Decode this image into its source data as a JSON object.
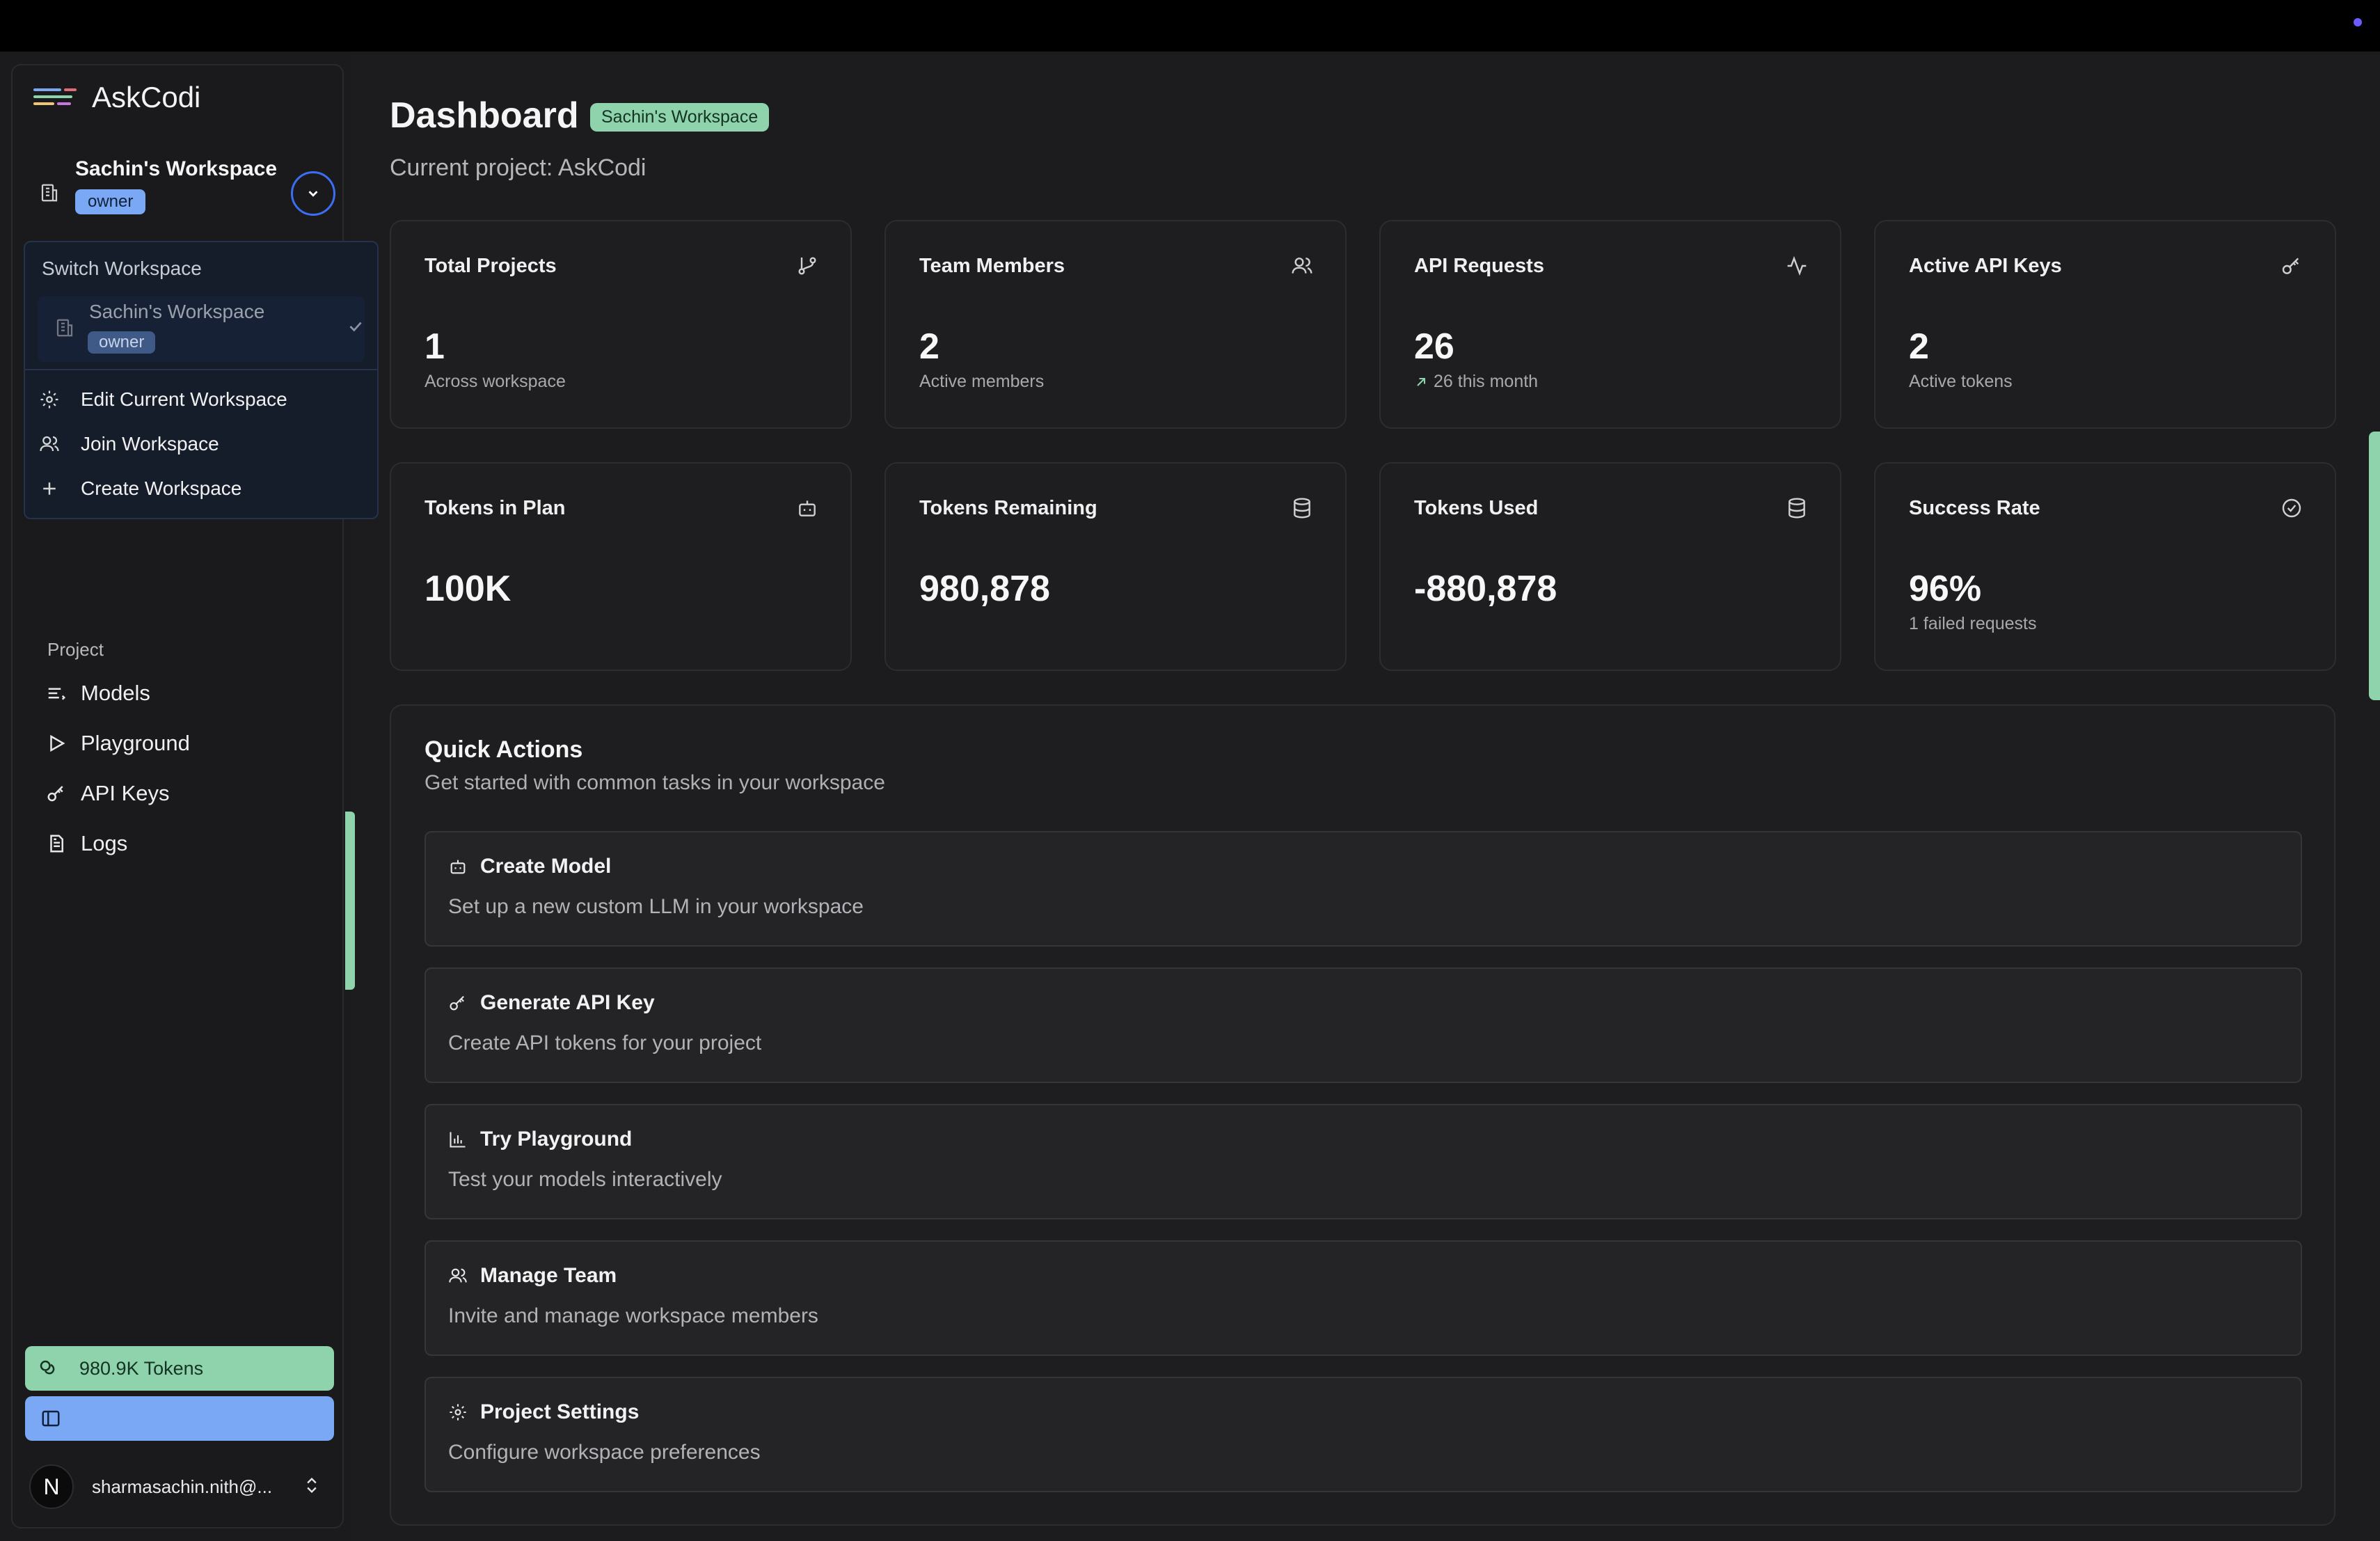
{
  "app": {
    "name": "AskCodi",
    "colors": {
      "accent_green": "#8fd3ad",
      "accent_blue": "#7aa8f5",
      "ring_blue": "#3b6ef2"
    }
  },
  "workspace": {
    "name": "Sachin's Workspace",
    "role": "owner"
  },
  "workspace_menu": {
    "title": "Switch Workspace",
    "items": [
      {
        "name": "Sachin's Workspace",
        "role": "owner",
        "selected": true
      }
    ],
    "actions": [
      {
        "label": "Edit Current Workspace",
        "icon": "gear-icon"
      },
      {
        "label": "Join Workspace",
        "icon": "users-icon"
      },
      {
        "label": "Create Workspace",
        "icon": "plus-icon"
      }
    ]
  },
  "sidebar": {
    "section_label": "Project",
    "items": [
      {
        "label": "Models",
        "icon": "list-icon"
      },
      {
        "label": "Playground",
        "icon": "play-icon"
      },
      {
        "label": "API Keys",
        "icon": "key-icon"
      },
      {
        "label": "Logs",
        "icon": "file-icon"
      }
    ],
    "tokens_label": "980.9K Tokens",
    "user_email": "sharmasachin.nith@...",
    "avatar_initial": "N"
  },
  "header": {
    "title": "Dashboard",
    "workspace_pill": "Sachin's Workspace",
    "subtitle": "Current project: AskCodi"
  },
  "stats": [
    {
      "label": "Total Projects",
      "value": "1",
      "sub": "Across workspace",
      "icon": "branch-icon"
    },
    {
      "label": "Team Members",
      "value": "2",
      "sub": "Active members",
      "icon": "users-icon"
    },
    {
      "label": "API Requests",
      "value": "26",
      "sub": "26 this month",
      "icon": "activity-icon",
      "trend": "up"
    },
    {
      "label": "Active API Keys",
      "value": "2",
      "sub": "Active tokens",
      "icon": "key-icon"
    },
    {
      "label": "Tokens in Plan",
      "value": "100K",
      "sub": "",
      "icon": "bot-icon"
    },
    {
      "label": "Tokens Remaining",
      "value": "980,878",
      "sub": "",
      "icon": "database-icon"
    },
    {
      "label": "Tokens Used",
      "value": "-880,878",
      "sub": "",
      "icon": "database-icon"
    },
    {
      "label": "Success Rate",
      "value": "96%",
      "sub": "1 failed requests",
      "icon": "check-circle-icon"
    }
  ],
  "quick_actions": {
    "title": "Quick Actions",
    "subtitle": "Get started with common tasks in your workspace",
    "items": [
      {
        "title": "Create Model",
        "desc": "Set up a new custom LLM in your workspace",
        "icon": "bot-icon"
      },
      {
        "title": "Generate API Key",
        "desc": "Create API tokens for your project",
        "icon": "key-icon"
      },
      {
        "title": "Try Playground",
        "desc": "Test your models interactively",
        "icon": "bar-chart-icon"
      },
      {
        "title": "Manage Team",
        "desc": "Invite and manage workspace members",
        "icon": "users-icon"
      },
      {
        "title": "Project Settings",
        "desc": "Configure workspace preferences",
        "icon": "gear-icon"
      }
    ]
  }
}
